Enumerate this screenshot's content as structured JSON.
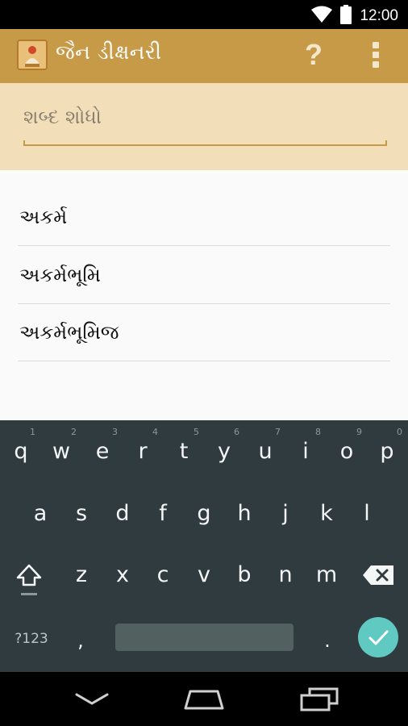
{
  "status_bar": {
    "time": "12:00"
  },
  "app_bar": {
    "title": "જૈન ડીક્ષનરી",
    "help_label": "?"
  },
  "search": {
    "placeholder": "શબ્દ શોધો",
    "value": ""
  },
  "results": [
    {
      "label": "અકર્મ"
    },
    {
      "label": "અકર્મભૂમિ"
    },
    {
      "label": "અકર્મભૂમિજ"
    }
  ],
  "keyboard": {
    "row1": [
      {
        "key": "q",
        "hint": "1"
      },
      {
        "key": "w",
        "hint": "2"
      },
      {
        "key": "e",
        "hint": "3"
      },
      {
        "key": "r",
        "hint": "4"
      },
      {
        "key": "t",
        "hint": "5"
      },
      {
        "key": "y",
        "hint": "6"
      },
      {
        "key": "u",
        "hint": "7"
      },
      {
        "key": "i",
        "hint": "8"
      },
      {
        "key": "o",
        "hint": "9"
      },
      {
        "key": "p",
        "hint": "0"
      }
    ],
    "row2": [
      "a",
      "s",
      "d",
      "f",
      "g",
      "h",
      "j",
      "k",
      "l"
    ],
    "row3": [
      "z",
      "x",
      "c",
      "v",
      "b",
      "n",
      "m"
    ],
    "symbols_label": "?123",
    "comma": ",",
    "period": "."
  },
  "colors": {
    "app_bar": "#c79a48",
    "search_background": "#f2deb8",
    "keyboard_background": "#2f3b3f",
    "done_key": "#5fc9c2"
  },
  "icons": [
    "wifi-icon",
    "battery-icon",
    "overflow-menu-icon",
    "shift-icon",
    "backspace-icon",
    "check-icon",
    "back-nav-icon",
    "home-nav-icon",
    "recents-nav-icon"
  ]
}
